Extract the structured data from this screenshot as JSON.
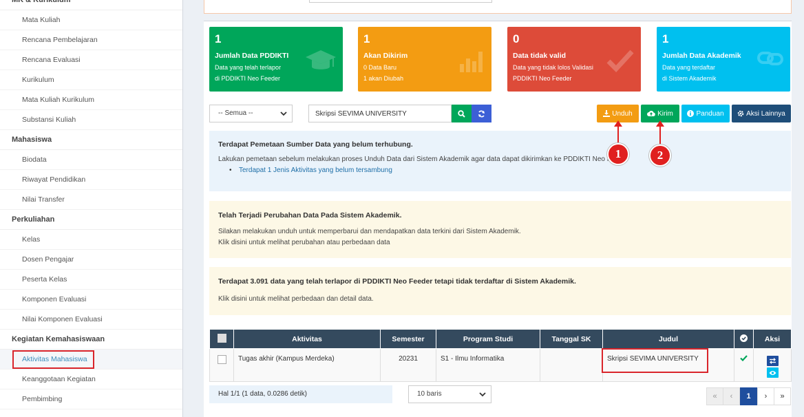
{
  "sidebar": {
    "sections": [
      {
        "title": "MK & Kurikulum",
        "items": [
          "Mata Kuliah",
          "Rencana Pembelajaran",
          "Rencana Evaluasi",
          "Kurikulum",
          "Mata Kuliah Kurikulum",
          "Substansi Kuliah"
        ]
      },
      {
        "title": "Mahasiswa",
        "items": [
          "Biodata",
          "Riwayat Pendidikan",
          "Nilai Transfer"
        ]
      },
      {
        "title": "Perkuliahan",
        "items": [
          "Kelas",
          "Dosen Pengajar",
          "Peserta Kelas",
          "Komponen Evaluasi",
          "Nilai Komponen Evaluasi"
        ]
      },
      {
        "title": "Kegiatan Kemahasiswaan",
        "items": [
          "Aktivitas Mahasiswa",
          "Keanggotaan Kegiatan",
          "Pembimbing"
        ]
      }
    ],
    "active_item": "Aktivitas Mahasiswa"
  },
  "stats": [
    {
      "count": "1",
      "title": "Jumlah Data PDDIKTI",
      "line1": "Data yang telah terlapor",
      "line2": "di PDDIKTI Neo Feeder",
      "color": "#00a65a",
      "icon": "graduation-cap-icon"
    },
    {
      "count": "1",
      "title": "Akan Dikirim",
      "line1": "0 Data Baru",
      "line2": "1 akan Diubah",
      "color": "#f39c12",
      "icon": "bar-chart-icon"
    },
    {
      "count": "0",
      "title": "Data tidak valid",
      "line1": "Data yang tidak lolos Validasi",
      "line2": "PDDIKTI Neo Feeder",
      "color": "#dd4b39",
      "icon": "checkmark-icon"
    },
    {
      "count": "1",
      "title": "Jumlah Data Akademik",
      "line1": "Data yang terdaftar",
      "line2": "di Sistem Akademik",
      "color": "#00c0ef",
      "icon": "link-icon"
    }
  ],
  "toolbar": {
    "filter_value": "-- Semua --",
    "search_value": "Skripsi SEVIMA UNIVERSITY",
    "unduh_label": "Unduh",
    "kirim_label": "Kirim",
    "panduan_label": "Panduan",
    "aksi_label": "Aksi Lainnya"
  },
  "markers": [
    "1",
    "2"
  ],
  "callouts": {
    "blue": {
      "title": "Terdapat Pemetaan Sumber Data yang belum terhubung.",
      "text": "Lakukan pemetaan sebelum melakukan proses Unduh Data dari Sistem Akademik agar data dapat dikirimkan ke PDDIKTI Neo Feeder",
      "bullet": "Terdapat 1 Jenis Aktivitas yang belum tersambung"
    },
    "yellow1": {
      "title": "Telah Terjadi Perubahan Data Pada Sistem Akademik.",
      "line1": "Silakan melakukan unduh untuk memperbarui dan mendapatkan data terkini dari Sistem Akademik.",
      "line2": "Klik disini untuk melihat perubahan atau perbedaan data"
    },
    "yellow2": {
      "title": "Terdapat 3.091 data yang telah terlapor di PDDIKTI Neo Feeder tetapi tidak terdaftar di Sistem Akademik.",
      "line1": "Klik disini untuk melihat perbedaan dan detail data."
    }
  },
  "table": {
    "headers": [
      "Aktivitas",
      "Semester",
      "Program Studi",
      "Tanggal SK",
      "Judul",
      "Aksi"
    ],
    "rows": [
      {
        "aktivitas": "Tugas akhir (Kampus Merdeka)",
        "semester": "20231",
        "prodi": "S1 - Ilmu Informatika",
        "tanggal_sk": "",
        "judul": "Skripsi SEVIMA UNIVERSITY",
        "status": "valid"
      }
    ]
  },
  "footer": {
    "info": "Hal 1/1 (1 data, 0.0286 detik)",
    "per_page": "10 baris",
    "pages": [
      "«",
      "‹",
      "1",
      "›",
      "»"
    ]
  }
}
